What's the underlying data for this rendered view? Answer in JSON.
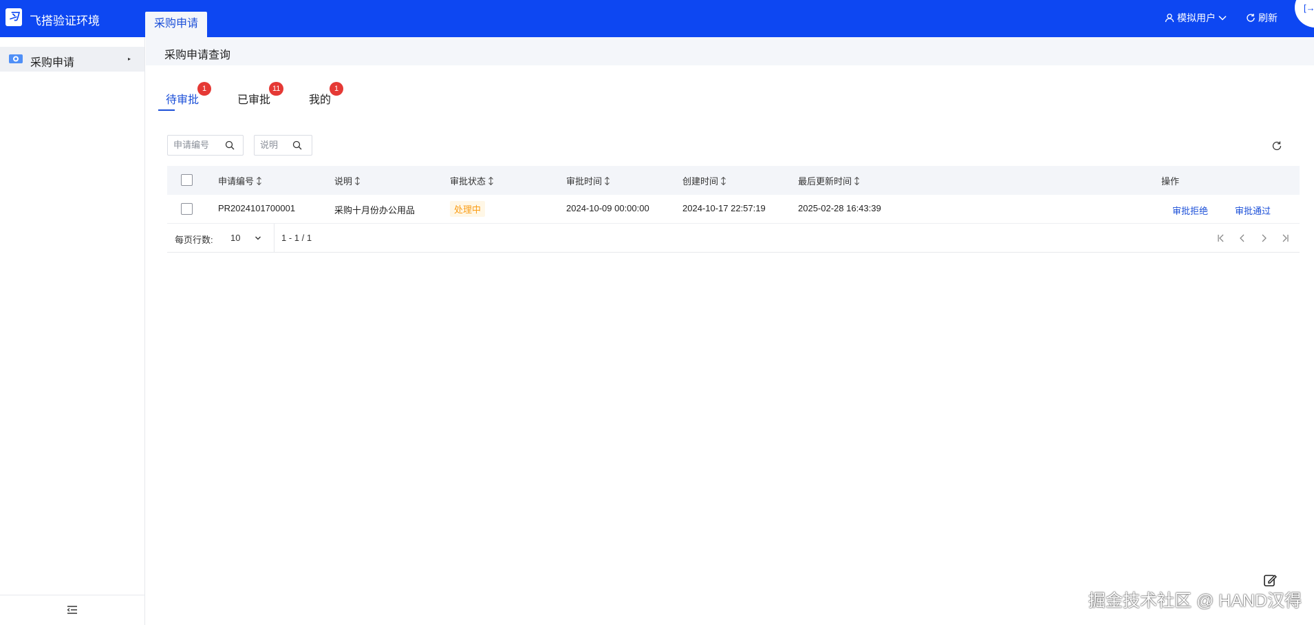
{
  "header": {
    "app_title": "飞搭验证环境",
    "open_tab": "采购申请",
    "user_label": "模拟用户",
    "refresh_label": "刷新"
  },
  "sidebar": {
    "items": [
      {
        "label": "采购申请"
      }
    ]
  },
  "breadcrumb": "采购申请查询",
  "tabs": [
    {
      "label": "待审批",
      "badge": "1",
      "active": true
    },
    {
      "label": "已审批",
      "badge": "11",
      "active": false
    },
    {
      "label": "我的",
      "badge": "1",
      "active": false
    }
  ],
  "search": {
    "code_placeholder": "申请编号",
    "desc_placeholder": "说明"
  },
  "table": {
    "columns": [
      "申请编号",
      "说明",
      "审批状态",
      "审批时间",
      "创建时间",
      "最后更新时间",
      "操作"
    ],
    "rows": [
      {
        "code": "PR2024101700001",
        "desc": "采购十月份办公用品",
        "status": "处理中",
        "approve_time": "2024-10-09 00:00:00",
        "create_time": "2024-10-17 22:57:19",
        "update_time": "2025-02-28 16:43:39",
        "actions": [
          "审批拒绝",
          "审批通过"
        ]
      }
    ]
  },
  "pagination": {
    "rows_per_page_label": "每页行数:",
    "rows_per_page": "10",
    "range": "1 - 1 / 1"
  },
  "watermark": "掘金技术社区 @ HAND汉得",
  "colors": {
    "header_bg": "#0d47f2",
    "accent": "#1b4fd8",
    "badge": "#e53935",
    "status_processing": "#fa9c14"
  }
}
